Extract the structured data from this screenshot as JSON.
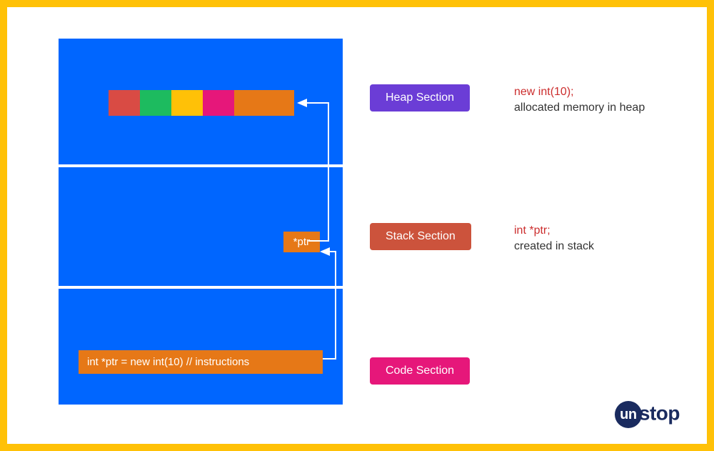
{
  "sections": {
    "heap": {
      "label": "Heap Section"
    },
    "stack": {
      "label": "Stack Section",
      "ptr": "*ptr"
    },
    "code": {
      "label": "Code Section",
      "instruction": "int *ptr = new int(10) // instructions"
    }
  },
  "descriptions": {
    "heap": {
      "code": "new int(10);",
      "text": "allocated memory in heap"
    },
    "stack": {
      "code": "int *ptr;",
      "text": "created in stack"
    }
  },
  "logo": {
    "badge": "un",
    "rest": "stop"
  }
}
